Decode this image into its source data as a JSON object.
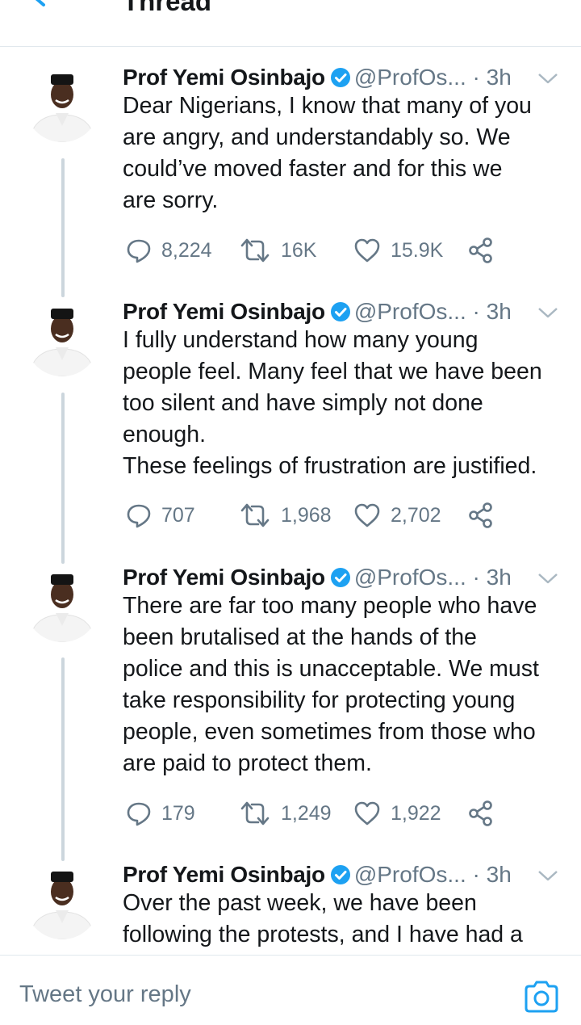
{
  "header": {
    "title": "Thread"
  },
  "tweets": [
    {
      "name": "Prof Yemi Osinbajo",
      "handle": "@ProfOs...",
      "dot": "·",
      "time": "3h",
      "text": "Dear Nigerians, I know that many of you\nare angry, and understandably so. We\ncould’ve moved faster and for this we\nare sorry.",
      "replies": "8,224",
      "retweets": "16K",
      "likes": "15.9K"
    },
    {
      "name": "Prof Yemi Osinbajo",
      "handle": "@ProfOs...",
      "dot": "·",
      "time": "3h",
      "text": "I fully understand how many young\npeople feel. Many feel that we have been\ntoo silent and have simply not done\nenough.\nThese feelings of frustration are justified.",
      "replies": "707",
      "retweets": "1,968",
      "likes": "2,702"
    },
    {
      "name": "Prof Yemi Osinbajo",
      "handle": "@ProfOs...",
      "dot": "·",
      "time": "3h",
      "text": "There are far too many people who have\nbeen brutalised at the hands of the\npolice and this is unacceptable. We must\ntake responsibility for protecting young\npeople, even sometimes from those who\nare paid to protect them.",
      "replies": "179",
      "retweets": "1,249",
      "likes": "1,922"
    },
    {
      "name": "Prof Yemi Osinbajo",
      "handle": "@ProfOs...",
      "dot": "·",
      "time": "3h",
      "text": "Over the past week, we have been\nfollowing the protests, and I have had a"
    }
  ],
  "reply": {
    "placeholder": "Tweet your reply"
  },
  "colors": {
    "accent": "#1da1f2",
    "muted": "#657786",
    "text": "#14171a",
    "line": "#ccd6dd"
  }
}
